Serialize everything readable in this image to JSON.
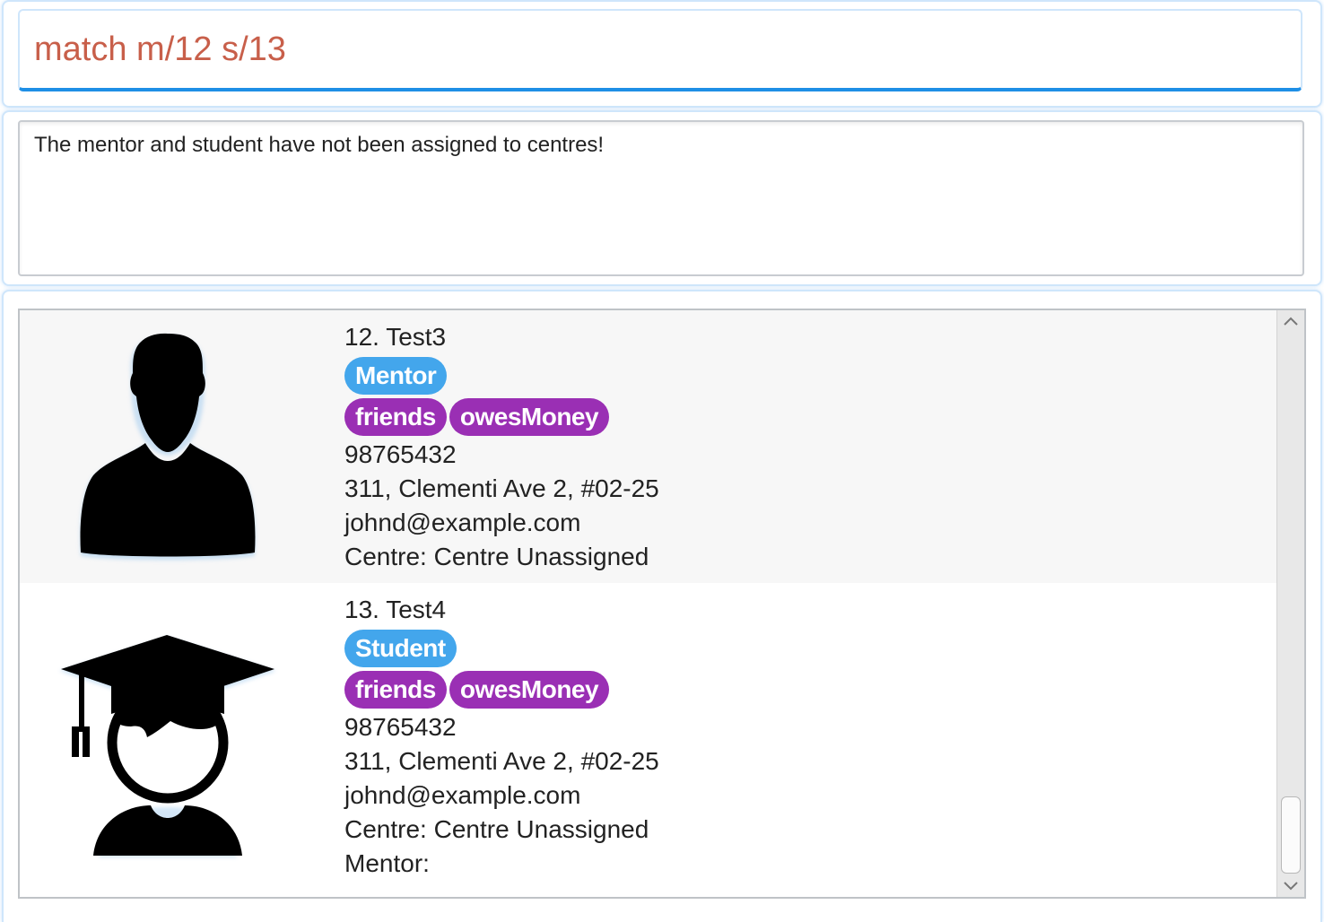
{
  "command": {
    "value": "match m/12 s/13"
  },
  "result": {
    "message": "The mentor and student have not been assigned to centres!"
  },
  "persons": [
    {
      "index_name": "12. Test3",
      "role": "Mentor",
      "tags": [
        "friends",
        "owesMoney"
      ],
      "phone": "98765432",
      "address": "311, Clementi Ave 2, #02-25",
      "email": "johnd@example.com",
      "centre": "Centre: Centre Unassigned",
      "avatar_icon": "mentor-avatar-icon"
    },
    {
      "index_name": "13. Test4",
      "role": "Student",
      "tags": [
        "friends",
        "owesMoney"
      ],
      "phone": "98765432",
      "address": "311, Clementi Ave 2, #02-25",
      "email": "johnd@example.com",
      "centre": "Centre: Centre Unassigned",
      "mentor": "Mentor:",
      "avatar_icon": "student-avatar-icon"
    }
  ],
  "colors": {
    "command_text": "#c85f4a",
    "role_tag": "#43a6ec",
    "label_tag": "#9a2fb4",
    "focus_border": "#1e8fe6"
  }
}
